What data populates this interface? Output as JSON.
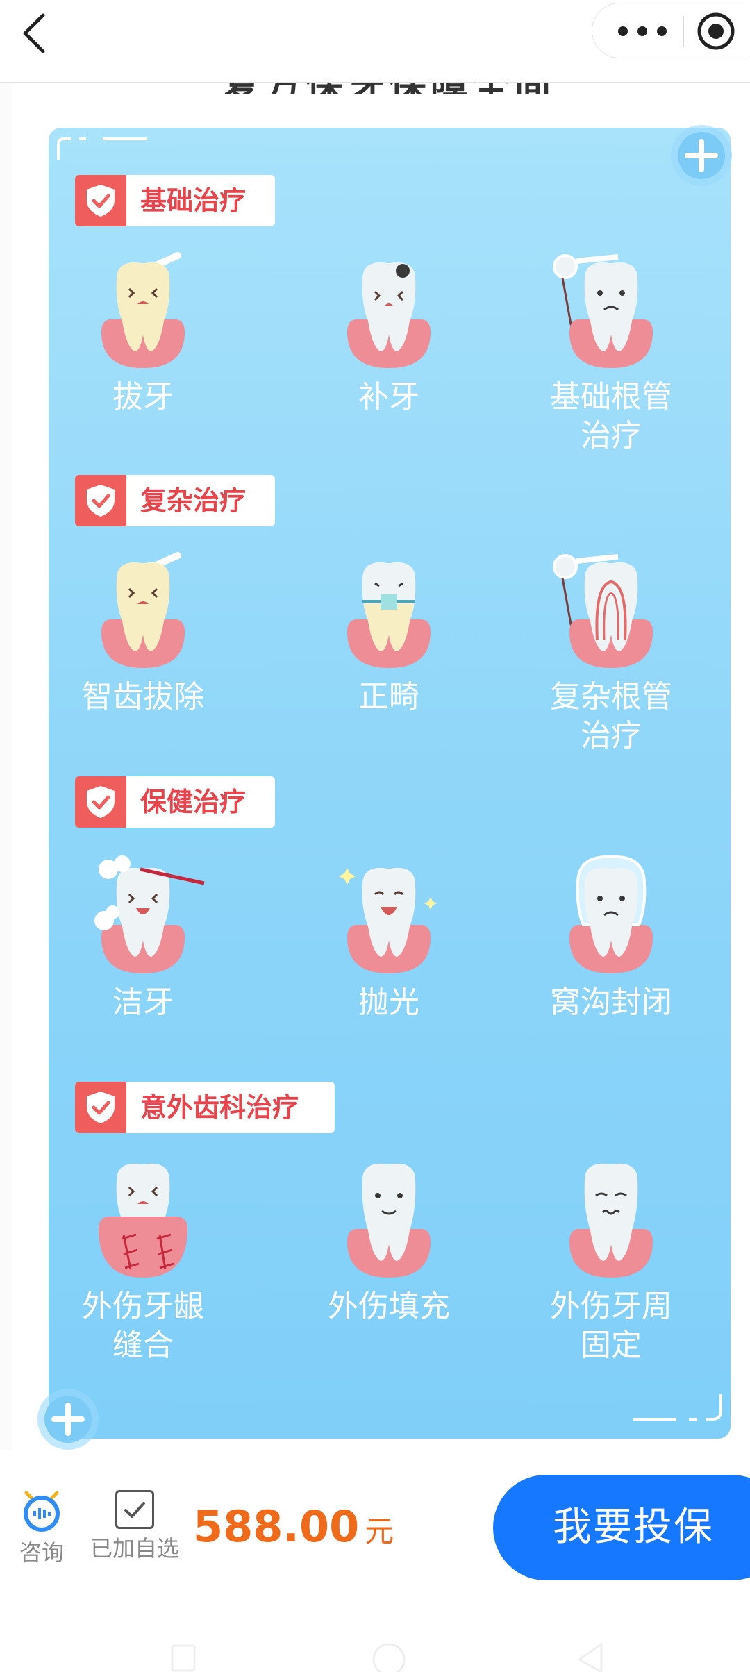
{
  "app": {
    "cut_title": "复方保牙保障全面",
    "colors": {
      "accent": "#1677ff",
      "price": "#f06a1c",
      "tag_text": "#e9434b",
      "card": "#8fd6f9"
    }
  },
  "topbar": {
    "back_icon": "chevron-left-icon",
    "more_icon": "more-dots-icon",
    "target_icon": "target-icon"
  },
  "sections": [
    {
      "title": "基础治疗",
      "items": [
        {
          "label": "拔牙"
        },
        {
          "label": "补牙"
        },
        {
          "label": "基础根管\n治疗"
        }
      ]
    },
    {
      "title": "复杂治疗",
      "items": [
        {
          "label": "智齿拔除"
        },
        {
          "label": "正畸"
        },
        {
          "label": "复杂根管\n治疗"
        }
      ]
    },
    {
      "title": "保健治疗",
      "items": [
        {
          "label": "洁牙"
        },
        {
          "label": "抛光"
        },
        {
          "label": "窝沟封闭"
        }
      ]
    },
    {
      "title": "意外齿科治疗",
      "items": [
        {
          "label": "外伤牙龈\n缝合"
        },
        {
          "label": "外伤填充"
        },
        {
          "label": "外伤牙周\n固定"
        }
      ]
    }
  ],
  "bottombar": {
    "consult_label": "咨询",
    "fav_label": "已加自选",
    "price": "588.00",
    "unit": "元",
    "buy_label": "我要投保"
  }
}
